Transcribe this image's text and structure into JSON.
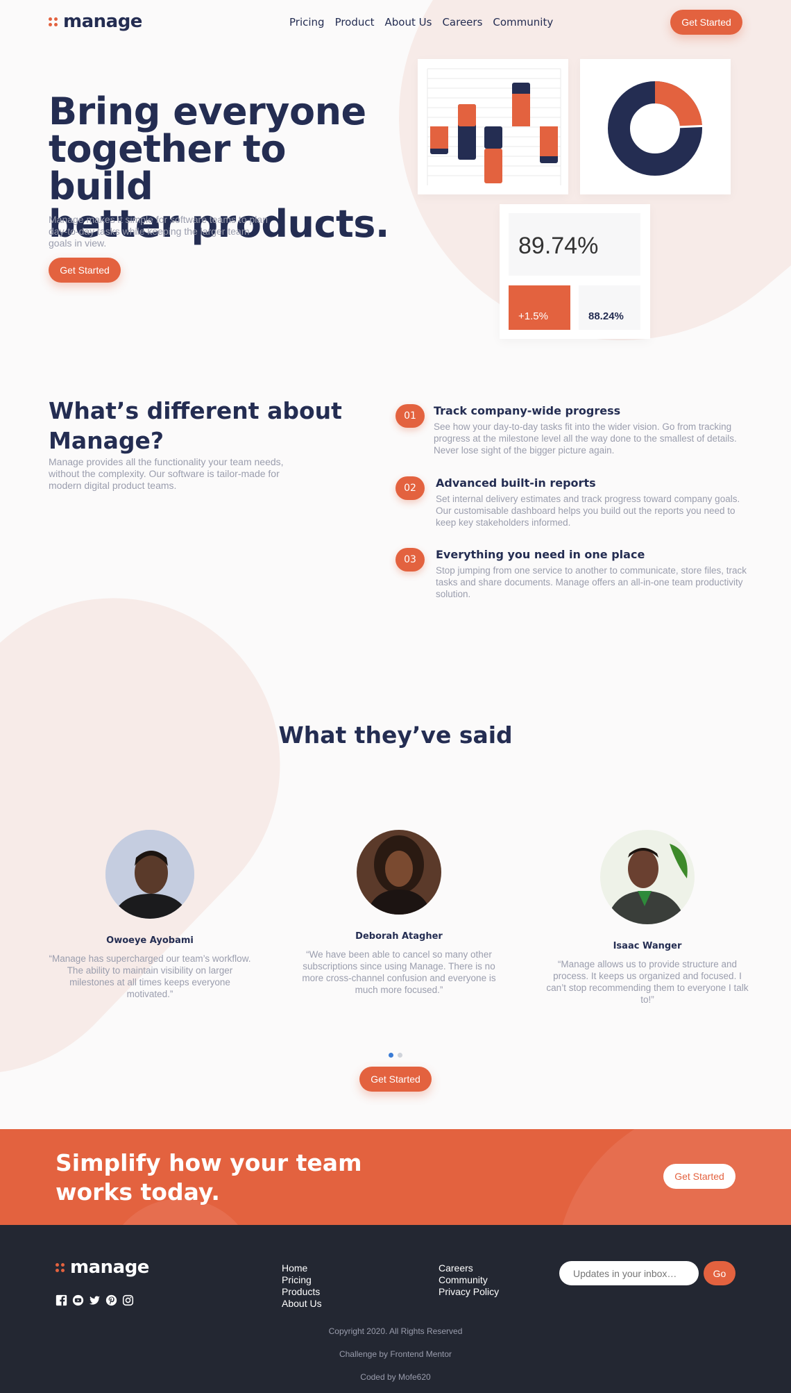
{
  "brand": {
    "name": "manage",
    "accent": "#e3623f",
    "dark": "#242d52"
  },
  "nav": {
    "items": [
      "Pricing",
      "Product",
      "About Us",
      "Careers",
      "Community"
    ],
    "cta": "Get Started"
  },
  "hero": {
    "title_lines": [
      "Bring everyone",
      "together to build",
      "better products."
    ],
    "subtitle": "Manage makes it simple for software teams to plan day-to-day tasks while keeping the larger team goals in view.",
    "cta": "Get Started",
    "stats": {
      "main": "89.74%",
      "change": "+1.5%",
      "secondary": "88.24%"
    },
    "donut_fraction_orange": 0.38
  },
  "features": {
    "title_lines": [
      "What’s different about",
      "Manage?"
    ],
    "text": "Manage provides all the functionality your team needs, without the complexity. Our software is tailor-made for modern digital product teams.",
    "items": [
      {
        "num": "01",
        "title": "Track company-wide progress",
        "text": "See how your day-to-day tasks fit into the wider vision. Go from tracking progress at the milestone level all the way done to the smallest of details. Never lose sight of the bigger picture again."
      },
      {
        "num": "02",
        "title": "Advanced built-in reports",
        "text": "Set internal delivery estimates and track progress toward company goals. Our customisable dashboard helps you build out the reports you need to keep key stakeholders informed."
      },
      {
        "num": "03",
        "title": "Everything you need in one place",
        "text": "Stop jumping from one service to another to communicate, store files, track tasks and share documents. Manage offers an all-in-one team productivity solution."
      }
    ]
  },
  "testimonials": {
    "title": "What they’ve said",
    "items": [
      {
        "name": "Owoeye Ayobami",
        "quote": "“Manage has supercharged our team’s workflow. The ability to maintain visibility on larger milestones at all times keeps everyone motivated.”"
      },
      {
        "name": "Deborah Atagher",
        "quote": "“We have been able to cancel so many other subscriptions since using Manage. There is no more cross-channel confusion and everyone is much more focused.”"
      },
      {
        "name": "Isaac Wanger",
        "quote": "“Manage allows us to provide structure and process. It keeps us organized and focused. I can’t stop recommending them to everyone I talk to!”"
      }
    ],
    "cta": "Get Started"
  },
  "cta_banner": {
    "title_lines": [
      "Simplify how your team",
      "works today."
    ],
    "button": "Get Started"
  },
  "footer": {
    "brand": "manage",
    "social_icons": [
      "facebook-icon",
      "youtube-icon",
      "twitter-icon",
      "pinterest-icon",
      "instagram-icon"
    ],
    "links_col1": [
      "Home",
      "Pricing",
      "Products",
      "About Us"
    ],
    "links_col2": [
      "Careers",
      "Community",
      "Privacy Policy"
    ],
    "newsletter": {
      "placeholder": "Updates in your inbox…",
      "button": "Go"
    },
    "copyright": "Copyright 2020. All Rights Reserved",
    "challenge": "Challenge by Frontend Mentor",
    "coded": "Coded by Mofe620"
  }
}
